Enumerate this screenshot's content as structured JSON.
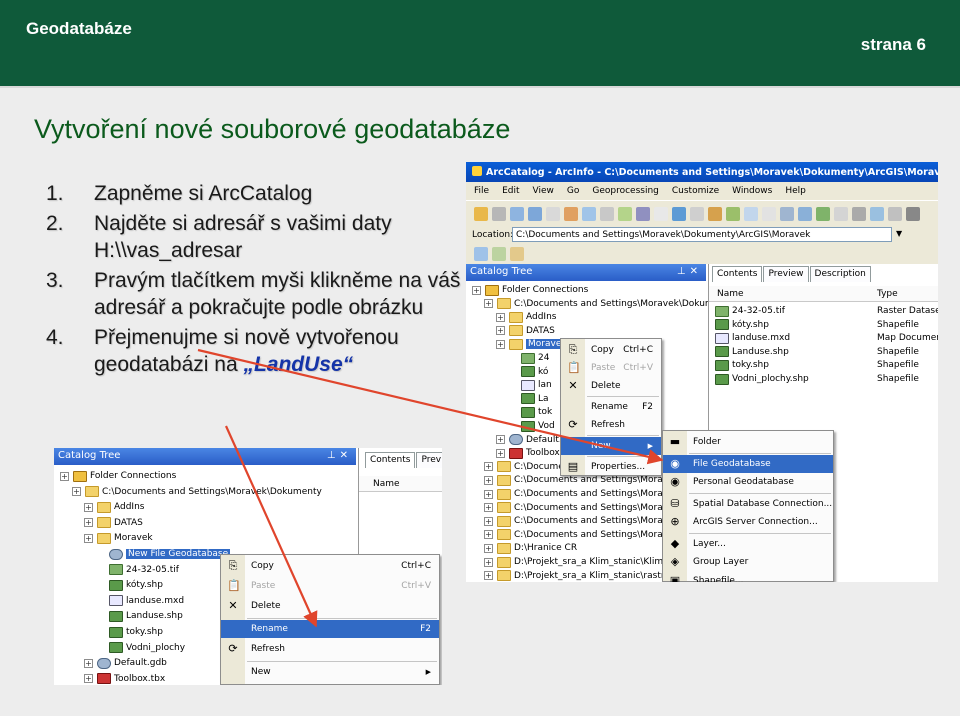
{
  "header": {
    "title": "Geodatabáze",
    "page": "strana 6"
  },
  "slide_title": "Vytvoření nové souborové geodatabáze",
  "steps": [
    {
      "num": "1.",
      "text": "Zapněme si ArcCatalog"
    },
    {
      "num": "2.",
      "text": "Najděte si adresář s vašimi daty H:\\\\vas_adresar"
    },
    {
      "num": "3.",
      "text": "Pravým tlačítkem myši klikněme na váš adresář a pokračujte podle obrázku"
    },
    {
      "num": "4.",
      "text_before": "Přejmenujme si nově vytvořenou geodatabázi na ",
      "accent": "„LandUse“"
    }
  ],
  "arccatalog": {
    "title": "ArcCatalog - ArcInfo - C:\\Documents and Settings\\Moravek\\Dokumenty\\ArcGIS\\Moravek",
    "menu": [
      "File",
      "Edit",
      "View",
      "Go",
      "Geoprocessing",
      "Customize",
      "Windows",
      "Help"
    ],
    "location_label": "Location:",
    "location_value": "C:\\Documents and Settings\\Moravek\\Dokumenty\\ArcGIS\\Moravek",
    "catalog_tree_title": "Catalog Tree",
    "tabs": [
      "Contents",
      "Preview",
      "Description"
    ],
    "columns": [
      "Name",
      "Type"
    ],
    "contents": [
      {
        "name": "24-32-05.tif",
        "type": "Raster Dataset",
        "icon": "raster-icon"
      },
      {
        "name": "kóty.shp",
        "type": "Shapefile",
        "icon": "shapefile-icon"
      },
      {
        "name": "landuse.mxd",
        "type": "Map Document",
        "icon": "map-document-icon"
      },
      {
        "name": "Landuse.shp",
        "type": "Shapefile",
        "icon": "shapefile-icon"
      },
      {
        "name": "toky.shp",
        "type": "Shapefile",
        "icon": "shapefile-icon"
      },
      {
        "name": "Vodni_plochy.shp",
        "type": "Shapefile",
        "icon": "shapefile-icon"
      }
    ],
    "tree": [
      {
        "label": "Folder Connections",
        "indent": 1,
        "icon": "connection"
      },
      {
        "label": "C:\\Documents and Settings\\Moravek\\Dokumenty",
        "indent": 2,
        "icon": "folder"
      },
      {
        "label": "AddIns",
        "indent": 3,
        "icon": "folder"
      },
      {
        "label": "DATAS",
        "indent": 3,
        "icon": "folder"
      },
      {
        "label": "Moravek",
        "indent": 3,
        "icon": "folder",
        "selected": true
      },
      {
        "label": "24",
        "indent": 4,
        "icon": "raster"
      },
      {
        "label": "kó",
        "indent": 4,
        "icon": "shp"
      },
      {
        "label": "lan",
        "indent": 4,
        "icon": "mxd"
      },
      {
        "label": "La",
        "indent": 4,
        "icon": "shp"
      },
      {
        "label": "tok",
        "indent": 4,
        "icon": "shp"
      },
      {
        "label": "Vod",
        "indent": 4,
        "icon": "shp"
      },
      {
        "label": "Default.",
        "indent": 3,
        "icon": "gdb"
      },
      {
        "label": "Toolbox.",
        "indent": 3,
        "icon": "tbx"
      },
      {
        "label": "C:\\Documents and Settings\\Moravek\\D",
        "indent": 2,
        "icon": "folder"
      },
      {
        "label": "C:\\Documents and Settings\\Moravek\\D",
        "indent": 2,
        "icon": "folder"
      },
      {
        "label": "C:\\Documents and Settings\\Moravek\\D",
        "indent": 2,
        "icon": "folder"
      },
      {
        "label": "C:\\Documents and Settings\\Moravek\\D",
        "indent": 2,
        "icon": "folder"
      },
      {
        "label": "C:\\Documents and Settings\\Moravek\\D",
        "indent": 2,
        "icon": "folder"
      },
      {
        "label": "C:\\Documents and Settings\\Moravek\\D",
        "indent": 2,
        "icon": "folder"
      },
      {
        "label": "D:\\Hranice CR",
        "indent": 2,
        "icon": "folder"
      },
      {
        "label": "D:\\Projekt_sra_a Klim_stanic\\Klim_s",
        "indent": 2,
        "icon": "folder"
      },
      {
        "label": "D:\\Projekt_sra_a Klim_stanic\\rastry",
        "indent": 2,
        "icon": "folder"
      }
    ],
    "context_menu": [
      {
        "label": "Copy",
        "shortcut": "Ctrl+C",
        "icon": "copy-icon"
      },
      {
        "label": "Paste",
        "shortcut": "Ctrl+V",
        "icon": "paste-icon",
        "disabled": true
      },
      {
        "label": "Delete",
        "shortcut": "",
        "icon": "delete-icon"
      },
      {
        "label": "Rename",
        "shortcut": "F2",
        "icon": ""
      },
      {
        "label": "Refresh",
        "shortcut": "",
        "icon": "refresh-icon"
      },
      {
        "label": "New",
        "shortcut": "",
        "icon": "",
        "highlighted": true,
        "submenu": true
      },
      {
        "label": "Properties...",
        "shortcut": "",
        "icon": "properties-icon"
      }
    ],
    "new_submenu": [
      {
        "label": "Folder",
        "icon": "folder-icon"
      },
      {
        "label": "File Geodatabase",
        "icon": "geodatabase-icon",
        "highlighted": true
      },
      {
        "label": "Personal Geodatabase",
        "icon": "geodatabase-icon"
      },
      {
        "label": "Spatial Database Connection...",
        "icon": "database-connection-icon"
      },
      {
        "label": "ArcGIS Server Connection...",
        "icon": "server-connection-icon"
      },
      {
        "label": "Layer...",
        "icon": "layer-icon"
      },
      {
        "label": "Group Layer",
        "icon": "group-layer-icon"
      },
      {
        "label": "Shapefile...",
        "icon": "shapefile-icon"
      }
    ]
  },
  "rename_shot": {
    "catalog_tree_title": "Catalog Tree",
    "tabs": [
      "Contents",
      "Prev"
    ],
    "column": "Name",
    "tree": [
      {
        "label": "Folder Connections",
        "indent": 1,
        "icon": "connection"
      },
      {
        "label": "C:\\Documents and Settings\\Moravek\\Dokumenty",
        "indent": 2,
        "icon": "folder"
      },
      {
        "label": "AddIns",
        "indent": 3,
        "icon": "folder"
      },
      {
        "label": "DATAS",
        "indent": 3,
        "icon": "folder"
      },
      {
        "label": "Moravek",
        "indent": 3,
        "icon": "folder"
      },
      {
        "label": "New File Geodatabase",
        "indent": 4,
        "icon": "gdb",
        "selected": true
      },
      {
        "label": "24-32-05.tif",
        "indent": 4,
        "icon": "raster"
      },
      {
        "label": "kóty.shp",
        "indent": 4,
        "icon": "shp"
      },
      {
        "label": "landuse.mxd",
        "indent": 4,
        "icon": "mxd"
      },
      {
        "label": "Landuse.shp",
        "indent": 4,
        "icon": "shp"
      },
      {
        "label": "toky.shp",
        "indent": 4,
        "icon": "shp"
      },
      {
        "label": "Vodni_plochy",
        "indent": 4,
        "icon": "shp"
      },
      {
        "label": "Default.gdb",
        "indent": 3,
        "icon": "gdb"
      },
      {
        "label": "Toolbox.tbx",
        "indent": 3,
        "icon": "tbx"
      }
    ],
    "context_menu": [
      {
        "label": "Copy",
        "shortcut": "Ctrl+C",
        "icon": "copy-icon"
      },
      {
        "label": "Paste",
        "shortcut": "Ctrl+V",
        "icon": "paste-icon",
        "disabled": true
      },
      {
        "label": "Delete",
        "shortcut": "",
        "icon": "delete-icon"
      },
      {
        "label": "Rename",
        "shortcut": "F2",
        "icon": "",
        "highlighted": true
      },
      {
        "label": "Refresh",
        "shortcut": "",
        "icon": "refresh-icon"
      },
      {
        "label": "New",
        "shortcut": "",
        "icon": "",
        "submenu": true
      }
    ]
  },
  "colors": {
    "header_bg": "#0f5a3a",
    "title": "#0b5a1c",
    "accent": "#1534a8",
    "arrow": "#e0452c",
    "selection": "#316ac5"
  }
}
